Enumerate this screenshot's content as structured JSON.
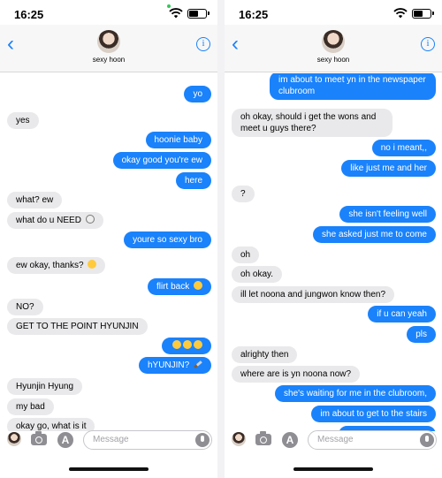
{
  "left": {
    "status": {
      "time": "16:25"
    },
    "header": {
      "contact_name": "sexy hoon"
    },
    "input": {
      "placeholder": "Message"
    },
    "messages": [
      {
        "text": "yo",
        "from": "me"
      },
      {
        "text": "yes",
        "from": "them"
      },
      {
        "text": "hoonie baby",
        "from": "me"
      },
      {
        "text": "okay good you're ew",
        "from": "me"
      },
      {
        "text": "here",
        "from": "me"
      },
      {
        "text": "what? ew",
        "from": "them"
      },
      {
        "text": "what do u NEED",
        "from": "them",
        "emoji": "skull"
      },
      {
        "text": "youre so sexy bro",
        "from": "me"
      },
      {
        "text": "ew okay, thanks?",
        "from": "them",
        "emoji": "laughing-crying"
      },
      {
        "text": "flirt back",
        "from": "me",
        "emoji": "grinning-sweat"
      },
      {
        "text": "NO?",
        "from": "them"
      },
      {
        "text": "GET TO THE POINT HYUNJIN",
        "from": "them"
      },
      {
        "text": "",
        "from": "me",
        "emoji": "three-smiling-faces"
      },
      {
        "text": "hYUNJIN?",
        "from": "me",
        "emoji": "knife"
      },
      {
        "text": "Hyunjin Hyung",
        "from": "them"
      },
      {
        "text": "my bad",
        "from": "them"
      },
      {
        "text": "okay go, what is it",
        "from": "them"
      }
    ]
  },
  "right": {
    "status": {
      "time": "16:25"
    },
    "header": {
      "contact_name": "sexy hoon"
    },
    "input": {
      "placeholder": "Message"
    },
    "messages": [
      {
        "text": "im about to meet yn in the newspaper clubroom",
        "from": "me"
      },
      {
        "text": "oh okay, should i get the wons and meet u guys there?",
        "from": "them"
      },
      {
        "text": "no i meant,,",
        "from": "me"
      },
      {
        "text": "like just me and her",
        "from": "me"
      },
      {
        "text": "?",
        "from": "them"
      },
      {
        "text": "she isn't feeling well",
        "from": "me"
      },
      {
        "text": "she asked just me to come",
        "from": "me"
      },
      {
        "text": "oh",
        "from": "them"
      },
      {
        "text": "oh okay.",
        "from": "them"
      },
      {
        "text": "ill let noona and jungwon know then?",
        "from": "them"
      },
      {
        "text": "if u can yeah",
        "from": "me"
      },
      {
        "text": "pls",
        "from": "me"
      },
      {
        "text": "alrighty then",
        "from": "them"
      },
      {
        "text": "where are is yn noona now?",
        "from": "them"
      },
      {
        "text": "she's waiting for me in the clubroom,",
        "from": "me"
      },
      {
        "text": "im about to get to the stairs",
        "from": "me"
      }
    ]
  },
  "colors": {
    "outgoing": "#1a82fb",
    "incoming": "#e9e9eb",
    "accent": "#1a82fb"
  },
  "icons": [
    "back-chevron-icon",
    "info-icon",
    "camera-icon",
    "app-store-icon",
    "microphone-icon",
    "wifi-icon",
    "battery-icon"
  ]
}
